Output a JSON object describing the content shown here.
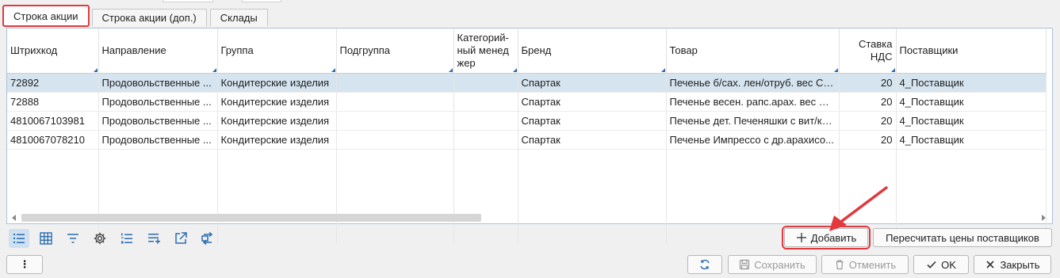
{
  "tabs": [
    {
      "label": "Строка акции",
      "active": true
    },
    {
      "label": "Строка акции (доп.)",
      "active": false
    },
    {
      "label": "Склады",
      "active": false
    }
  ],
  "grid": {
    "columns": [
      "Штрихкод",
      "Направление",
      "Группа",
      "Подгруппа",
      "Категорий-ный менеджер",
      "Бренд",
      "Товар",
      "Ставка НДС",
      "Поставщики"
    ],
    "rows": [
      [
        "72892",
        "Продовольственные ...",
        "Кондитерские изделия",
        "",
        "",
        "Спартак",
        "Печенье б/сах. лен/отруб. вес Сп...",
        "20",
        "4_Поставщик"
      ],
      [
        "72888",
        "Продовольственные ...",
        "Кондитерские изделия",
        "",
        "",
        "Спартак",
        "Печенье весен. рапс.арах. вес Сп...",
        "20",
        "4_Поставщик"
      ],
      [
        "4810067103981",
        "Продовольственные ...",
        "Кондитерские изделия",
        "",
        "",
        "Спартак",
        "Печенье дет. Печеняшки с вит/ка...",
        "20",
        "4_Поставщик"
      ],
      [
        "4810067078210",
        "Продовольственные ...",
        "Кондитерские изделия",
        "",
        "",
        "Спартак",
        "Печенье Импрессо с др.арахисо...",
        "20",
        "4_Поставщик"
      ]
    ]
  },
  "toolbar_icons": [
    "list-view-icon",
    "grid-view-icon",
    "filter-icon",
    "settings-gear-icon",
    "numbered-list-icon",
    "add-rows-icon",
    "export-icon",
    "transfer-icon"
  ],
  "actions": {
    "add_label": "Добавить",
    "recalc_label": "Пересчитать цены поставщиков",
    "menu_label": "⋮",
    "save_label": "Сохранить",
    "cancel_label": "Отменить",
    "ok_label": "OK",
    "close_label": "Закрыть"
  },
  "colors": {
    "highlight": "#e0393e",
    "selection": "#d5e4ef",
    "accent": "#2b6cb0"
  }
}
